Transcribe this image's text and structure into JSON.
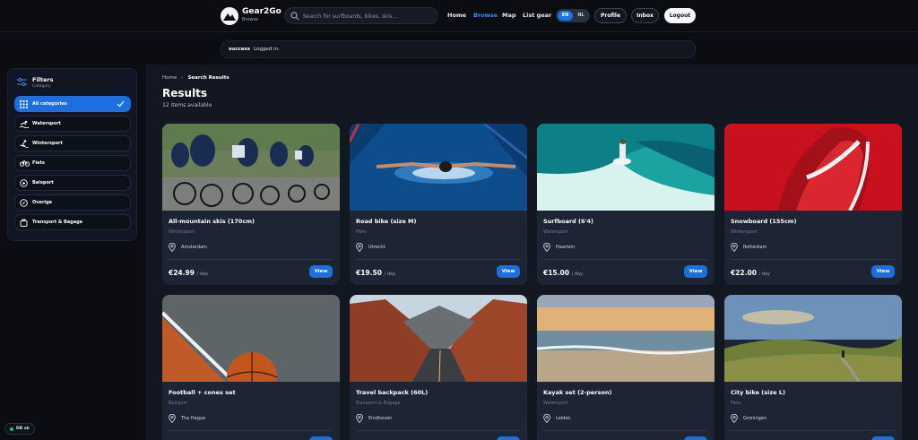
{
  "header": {
    "brand_name": "Gear2Go",
    "brand_sub": "Browse",
    "search_placeholder": "Search for surfboards, bikes, skis...",
    "nav": [
      "Home",
      "Browse",
      "Map",
      "List gear"
    ],
    "lang_en": "EN",
    "lang_nl": "NL",
    "profile": "Profile",
    "inbox": "Inbox",
    "logout": "Logout"
  },
  "toast": {
    "status": "success",
    "message": "Logged in."
  },
  "sidebar": {
    "title": "Filters",
    "subtitle": "Category",
    "categories": [
      "All categories",
      "Watersport",
      "Wintersport",
      "Fiets",
      "Balsport",
      "Overige",
      "Transport & Bagage"
    ]
  },
  "status_badge": "DB ok",
  "content": {
    "breadcrumb_home": "Home",
    "breadcrumb_current": "Search Results",
    "title": "Results",
    "count": "12 items available",
    "per_day": "/ day",
    "view_label": "View"
  },
  "items": [
    {
      "title": "All-mountain skis (170cm)",
      "category": "Wintersport",
      "location": "Amsterdam",
      "price": "€24.99"
    },
    {
      "title": "Road bike (size M)",
      "category": "Fiets",
      "location": "Utrecht",
      "price": "€19.50"
    },
    {
      "title": "Surfboard (6'4)",
      "category": "Watersport",
      "location": "Haarlem",
      "price": "€15.00"
    },
    {
      "title": "Snowboard (155cm)",
      "category": "Wintersport",
      "location": "Rotterdam",
      "price": "€22.00"
    },
    {
      "title": "Football + cones set",
      "category": "Balsport",
      "location": "The Hague",
      "price": ""
    },
    {
      "title": "Travel backpack (60L)",
      "category": "Transport & Bagage",
      "location": "Eindhoven",
      "price": ""
    },
    {
      "title": "Kayak set (2-person)",
      "category": "Watersport",
      "location": "Leiden",
      "price": ""
    },
    {
      "title": "City bike (size L)",
      "category": "Fiets",
      "location": "Groningen",
      "price": ""
    }
  ]
}
